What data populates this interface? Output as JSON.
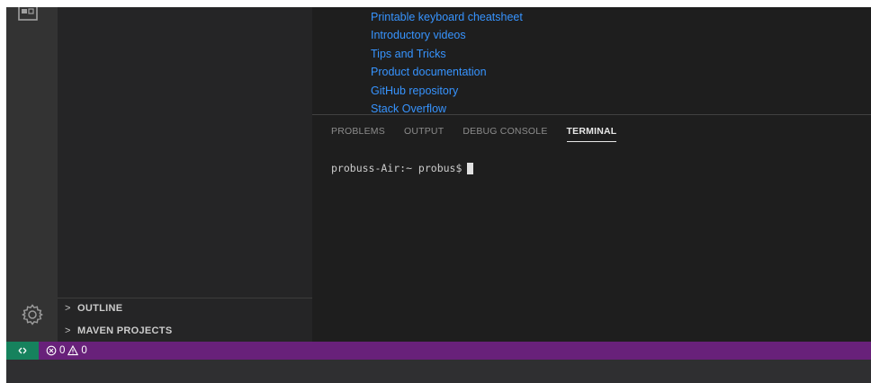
{
  "editor": {
    "links": [
      "Printable keyboard cheatsheet",
      "Introductory videos",
      "Tips and Tricks",
      "Product documentation",
      "GitHub repository",
      "Stack Overflow"
    ]
  },
  "sidebar": {
    "sections": [
      {
        "label": "OUTLINE"
      },
      {
        "label": "MAVEN PROJECTS"
      }
    ]
  },
  "panel": {
    "tabs": [
      {
        "label": "PROBLEMS",
        "active": false
      },
      {
        "label": "OUTPUT",
        "active": false
      },
      {
        "label": "DEBUG CONSOLE",
        "active": false
      },
      {
        "label": "TERMINAL",
        "active": true
      }
    ],
    "terminal": {
      "prompt": "probuss-Air:~ probus$"
    }
  },
  "statusbar": {
    "errors": "0",
    "warnings": "0"
  },
  "colors": {
    "statusbar": "#68217a",
    "remote": "#16825d",
    "link": "#3794ff",
    "activity_bar": "#333333",
    "sidebar": "#252526",
    "editor": "#1e1e1e"
  },
  "icons": {
    "activity_top": "explorer-icon",
    "activity_bottom": "gear-icon",
    "remote": "remote-icon",
    "errors": "error-icon",
    "warnings": "warning-icon",
    "section": "chevron-right-icon"
  }
}
